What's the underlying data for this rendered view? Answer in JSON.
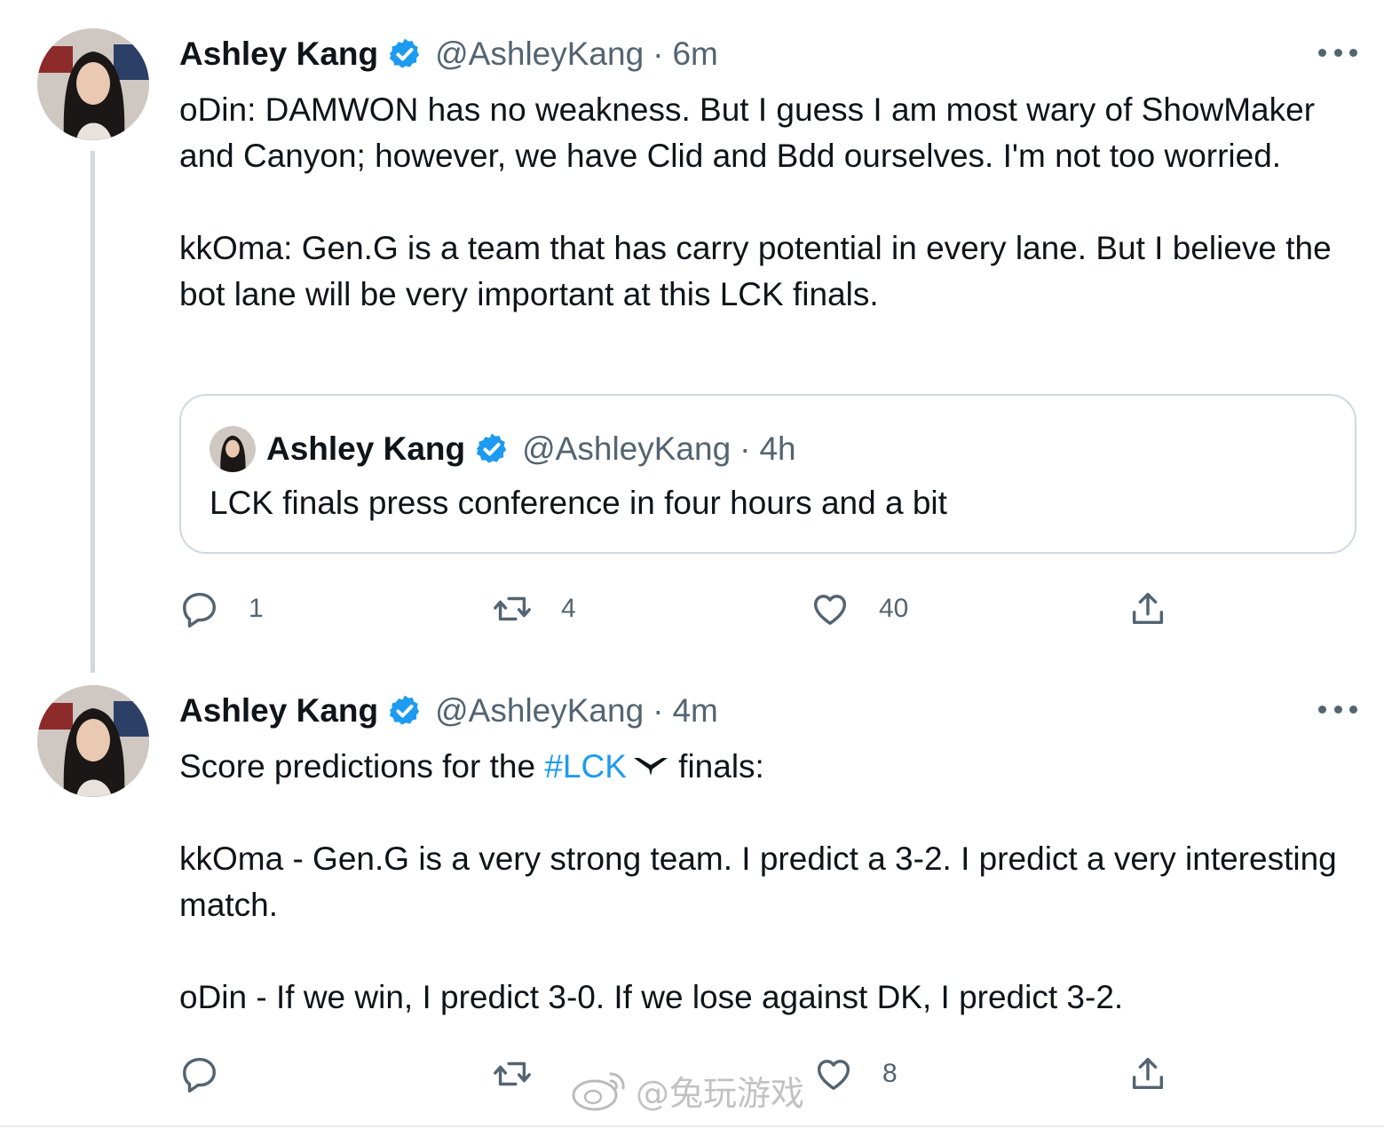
{
  "colors": {
    "accent": "#1d9bf0",
    "text": "#0f1419",
    "muted": "#536471",
    "border": "#cfd9de"
  },
  "tweets": [
    {
      "author": {
        "name": "Ashley Kang",
        "handle": "@AshleyKang"
      },
      "separator": "·",
      "time": "6m",
      "paragraphs": [
        "oDin: DAMWON has no weakness. But I guess I am most wary of ShowMaker and Canyon; however, we have Clid and Bdd ourselves. I'm not too worried.",
        "kkOma: Gen.G is a team that has carry potential in every lane. But I believe the bot lane will be very important at this LCK finals."
      ],
      "quote": {
        "author": {
          "name": "Ashley Kang",
          "handle": "@AshleyKang"
        },
        "separator": "·",
        "time": "4h",
        "text": "LCK finals press conference in four hours and a bit"
      },
      "actions": {
        "reply_count": "1",
        "retweet_count": "4",
        "like_count": "40"
      }
    },
    {
      "author": {
        "name": "Ashley Kang",
        "handle": "@AshleyKang"
      },
      "separator": "·",
      "time": "4m",
      "line1": {
        "before": "Score predictions for the ",
        "hashtag": "#LCK",
        "after": " finals:"
      },
      "paragraphs": [
        "kkOma - Gen.G is a very strong team. I predict a 3-2. I predict a very interesting match.",
        "oDin - If we win, I predict 3-0. If we lose against DK, I predict 3-2."
      ],
      "actions": {
        "reply_count": "",
        "retweet_count": "",
        "like_count": "8"
      }
    }
  ],
  "watermark": {
    "text": "@兔玩游戏"
  },
  "icons": [
    "verified-badge-icon",
    "more-icon",
    "reply-icon",
    "retweet-icon",
    "like-icon",
    "share-icon",
    "weibo-logo-icon",
    "lck-emblem-icon"
  ]
}
